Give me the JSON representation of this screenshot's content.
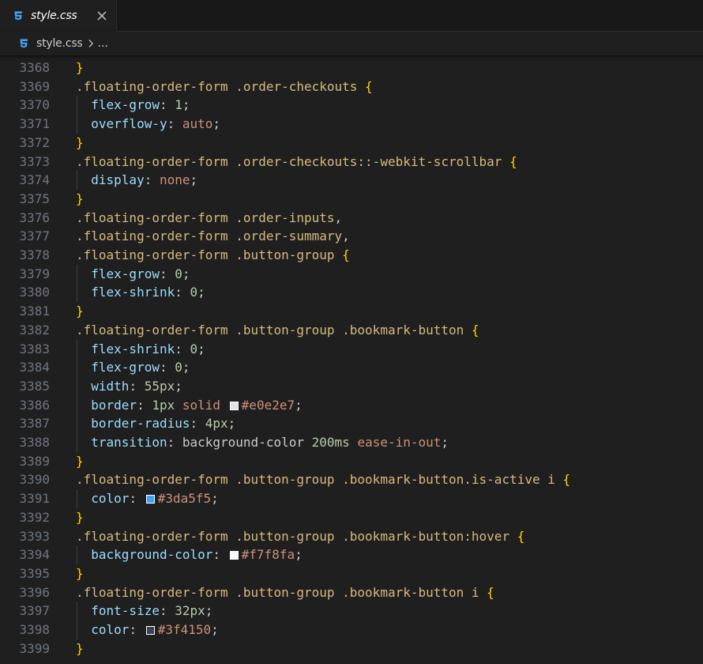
{
  "tab": {
    "filename": "style.css"
  },
  "breadcrumb": {
    "filename": "style.css",
    "ellipsis": "..."
  },
  "icons": {
    "file_icon": "css3-icon",
    "close_icon": "close-icon",
    "chevron_icon": "chevron-right-icon"
  },
  "colors": {
    "css_icon": "#42a5f5",
    "selector": "#d7ba7d",
    "property": "#9cdcfe",
    "number": "#b5cea8",
    "value": "#ce9178",
    "brace": "#ffd700"
  },
  "lines": [
    {
      "num": "3368",
      "tokens": [
        [
          "brace",
          "}"
        ]
      ]
    },
    {
      "num": "3369",
      "tokens": [
        [
          "sel",
          ".floating-order-form .order-checkouts "
        ],
        [
          "brace",
          "{"
        ]
      ]
    },
    {
      "num": "3370",
      "tokens": [
        [
          "indent",
          "  "
        ],
        [
          "prop",
          "flex-grow"
        ],
        [
          "punc",
          ": "
        ],
        [
          "num",
          "1"
        ],
        [
          "punc",
          ";"
        ]
      ]
    },
    {
      "num": "3371",
      "tokens": [
        [
          "indent",
          "  "
        ],
        [
          "prop",
          "overflow-y"
        ],
        [
          "punc",
          ": "
        ],
        [
          "val",
          "auto"
        ],
        [
          "punc",
          ";"
        ]
      ]
    },
    {
      "num": "3372",
      "tokens": [
        [
          "brace",
          "}"
        ]
      ]
    },
    {
      "num": "3373",
      "tokens": [
        [
          "sel",
          ".floating-order-form .order-checkouts::-webkit-scrollbar "
        ],
        [
          "brace",
          "{"
        ]
      ]
    },
    {
      "num": "3374",
      "tokens": [
        [
          "indent",
          "  "
        ],
        [
          "prop",
          "display"
        ],
        [
          "punc",
          ": "
        ],
        [
          "val",
          "none"
        ],
        [
          "punc",
          ";"
        ]
      ]
    },
    {
      "num": "3375",
      "tokens": [
        [
          "brace",
          "}"
        ]
      ]
    },
    {
      "num": "3376",
      "tokens": [
        [
          "sel",
          ".floating-order-form .order-inputs"
        ],
        [
          "punc",
          ","
        ]
      ]
    },
    {
      "num": "3377",
      "tokens": [
        [
          "sel",
          ".floating-order-form .order-summary"
        ],
        [
          "punc",
          ","
        ]
      ]
    },
    {
      "num": "3378",
      "tokens": [
        [
          "sel",
          ".floating-order-form .button-group "
        ],
        [
          "brace",
          "{"
        ]
      ]
    },
    {
      "num": "3379",
      "tokens": [
        [
          "indent",
          "  "
        ],
        [
          "prop",
          "flex-grow"
        ],
        [
          "punc",
          ": "
        ],
        [
          "num",
          "0"
        ],
        [
          "punc",
          ";"
        ]
      ]
    },
    {
      "num": "3380",
      "tokens": [
        [
          "indent",
          "  "
        ],
        [
          "prop",
          "flex-shrink"
        ],
        [
          "punc",
          ": "
        ],
        [
          "num",
          "0"
        ],
        [
          "punc",
          ";"
        ]
      ]
    },
    {
      "num": "3381",
      "tokens": [
        [
          "brace",
          "}"
        ]
      ]
    },
    {
      "num": "3382",
      "tokens": [
        [
          "sel",
          ".floating-order-form .button-group .bookmark-button "
        ],
        [
          "brace",
          "{"
        ]
      ]
    },
    {
      "num": "3383",
      "tokens": [
        [
          "indent",
          "  "
        ],
        [
          "prop",
          "flex-shrink"
        ],
        [
          "punc",
          ": "
        ],
        [
          "num",
          "0"
        ],
        [
          "punc",
          ";"
        ]
      ]
    },
    {
      "num": "3384",
      "tokens": [
        [
          "indent",
          "  "
        ],
        [
          "prop",
          "flex-grow"
        ],
        [
          "punc",
          ": "
        ],
        [
          "num",
          "0"
        ],
        [
          "punc",
          ";"
        ]
      ]
    },
    {
      "num": "3385",
      "tokens": [
        [
          "indent",
          "  "
        ],
        [
          "prop",
          "width"
        ],
        [
          "punc",
          ": "
        ],
        [
          "num",
          "55px"
        ],
        [
          "punc",
          ";"
        ]
      ]
    },
    {
      "num": "3386",
      "tokens": [
        [
          "indent",
          "  "
        ],
        [
          "prop",
          "border"
        ],
        [
          "punc",
          ": "
        ],
        [
          "num",
          "1px"
        ],
        [
          "punc",
          " "
        ],
        [
          "val",
          "solid "
        ],
        [
          "swatch",
          "#e0e2e7"
        ],
        [
          "val",
          "#e0e2e7"
        ],
        [
          "punc",
          ";"
        ]
      ]
    },
    {
      "num": "3387",
      "tokens": [
        [
          "indent",
          "  "
        ],
        [
          "prop",
          "border-radius"
        ],
        [
          "punc",
          ": "
        ],
        [
          "num",
          "4px"
        ],
        [
          "punc",
          ";"
        ]
      ]
    },
    {
      "num": "3388",
      "tokens": [
        [
          "indent",
          "  "
        ],
        [
          "prop",
          "transition"
        ],
        [
          "punc",
          ": background-color "
        ],
        [
          "num",
          "200ms"
        ],
        [
          "punc",
          " "
        ],
        [
          "val",
          "ease-in-out"
        ],
        [
          "punc",
          ";"
        ]
      ]
    },
    {
      "num": "3389",
      "tokens": [
        [
          "brace",
          "}"
        ]
      ]
    },
    {
      "num": "3390",
      "tokens": [
        [
          "sel",
          ".floating-order-form .button-group .bookmark-button.is-active i "
        ],
        [
          "brace",
          "{"
        ]
      ]
    },
    {
      "num": "3391",
      "tokens": [
        [
          "indent",
          "  "
        ],
        [
          "prop",
          "color"
        ],
        [
          "punc",
          ": "
        ],
        [
          "swatch",
          "#3da5f5"
        ],
        [
          "val",
          "#3da5f5"
        ],
        [
          "punc",
          ";"
        ]
      ]
    },
    {
      "num": "3392",
      "tokens": [
        [
          "brace",
          "}"
        ]
      ]
    },
    {
      "num": "3393",
      "tokens": [
        [
          "sel",
          ".floating-order-form .button-group .bookmark-button:hover "
        ],
        [
          "brace",
          "{"
        ]
      ]
    },
    {
      "num": "3394",
      "tokens": [
        [
          "indent",
          "  "
        ],
        [
          "prop",
          "background-color"
        ],
        [
          "punc",
          ": "
        ],
        [
          "swatch",
          "#f7f8fa"
        ],
        [
          "val",
          "#f7f8fa"
        ],
        [
          "punc",
          ";"
        ]
      ]
    },
    {
      "num": "3395",
      "tokens": [
        [
          "brace",
          "}"
        ]
      ]
    },
    {
      "num": "3396",
      "tokens": [
        [
          "sel",
          ".floating-order-form .button-group .bookmark-button i "
        ],
        [
          "brace",
          "{"
        ]
      ]
    },
    {
      "num": "3397",
      "tokens": [
        [
          "indent",
          "  "
        ],
        [
          "prop",
          "font-size"
        ],
        [
          "punc",
          ": "
        ],
        [
          "num",
          "32px"
        ],
        [
          "punc",
          ";"
        ]
      ]
    },
    {
      "num": "3398",
      "tokens": [
        [
          "indent",
          "  "
        ],
        [
          "prop",
          "color"
        ],
        [
          "punc",
          ": "
        ],
        [
          "swatch",
          "#3f4150"
        ],
        [
          "val",
          "#3f4150"
        ],
        [
          "punc",
          ";"
        ]
      ]
    },
    {
      "num": "3399",
      "tokens": [
        [
          "brace",
          "}"
        ]
      ]
    }
  ]
}
